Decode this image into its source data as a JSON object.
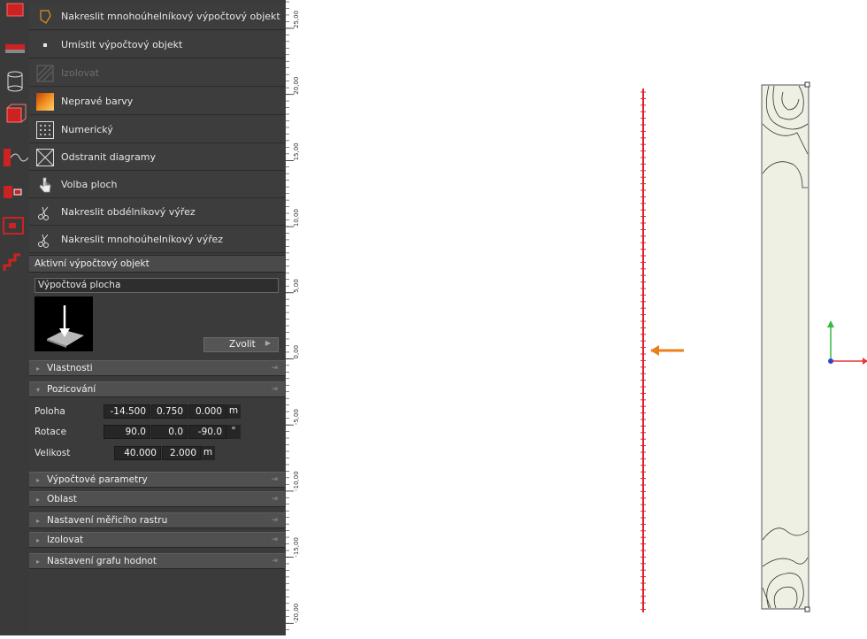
{
  "menu": {
    "items": [
      {
        "label": "Nakreslit mnohoúhelníkový výpočtový objekt",
        "icon": "polygon-object-icon",
        "disabled": false
      },
      {
        "label": "Umístit výpočtový objekt",
        "icon": "bullet-icon",
        "disabled": false
      },
      {
        "label": "Izolovat",
        "icon": "isolate-icon",
        "disabled": true
      },
      {
        "label": "Nepravé barvy",
        "icon": "false-colors-icon",
        "disabled": false
      },
      {
        "label": "Numerický",
        "icon": "numeric-grid-icon",
        "disabled": false
      },
      {
        "label": "Odstranit diagramy",
        "icon": "remove-diagrams-icon",
        "disabled": false
      },
      {
        "label": "Volba ploch",
        "icon": "hand-pointer-icon",
        "disabled": false
      },
      {
        "label": "Nakreslit obdélníkový výřez",
        "icon": "scissors-icon",
        "disabled": false
      },
      {
        "label": "Nakreslit mnohoúhelníkový výřez",
        "icon": "scissors-icon",
        "disabled": false
      }
    ]
  },
  "active_object": {
    "title": "Aktivní výpočtový objekt",
    "name": "Výpočtová plocha",
    "choose_label": "Zvolit"
  },
  "sections": {
    "properties": "Vlastnosti",
    "positioning": "Pozicování",
    "calc_params": "Výpočtové parametry",
    "area": "Oblast",
    "grid_settings": "Nastavení měřicího rastru",
    "isolate": "Izolovat",
    "value_chart": "Nastavení grafu hodnot"
  },
  "positioning": {
    "position": {
      "label": "Poloha",
      "x": "-14.500",
      "y": "0.750",
      "z": "0.000",
      "unit": "m"
    },
    "rotation": {
      "label": "Rotace",
      "x": "90.0",
      "y": "0.0",
      "z": "-90.0",
      "unit": "°"
    },
    "size": {
      "label": "Velikost",
      "x": "40.000",
      "y": "2.000",
      "unit": "m"
    }
  },
  "ruler": {
    "labels": [
      "25,00",
      "20,00",
      "15,00",
      "10,00",
      "5,00",
      "0,00",
      "-5,00",
      "-10,00",
      "-15,00",
      "-20,00"
    ]
  },
  "colors": {
    "panel_bg": "#3b3b3b",
    "red_line": "#e0202a",
    "orange_arrow": "#e8801c",
    "surface_fill": "#eef0e4",
    "axis_green": "#33bb44",
    "axis_red": "#ee3333",
    "axis_blue": "#3344cc"
  }
}
